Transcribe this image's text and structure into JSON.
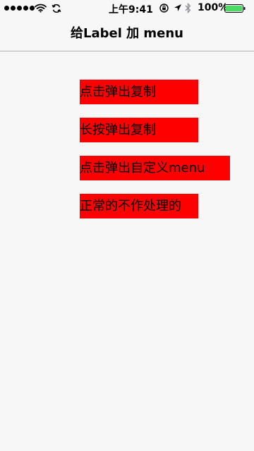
{
  "status_bar": {
    "time": "上午9:41",
    "battery_percent": "100%",
    "battery_color": "#4cd964",
    "icons": [
      "signal-dots-icon",
      "wifi-icon",
      "sync-icon",
      "lock-rotation-icon",
      "location-icon",
      "bluetooth-icon",
      "battery-icon"
    ]
  },
  "nav": {
    "title": "给Label 加 menu"
  },
  "labels": [
    {
      "text": "点击弹出复制"
    },
    {
      "text": "长按弹出复制"
    },
    {
      "text": "点击弹出自定义menu"
    },
    {
      "text": "正常的不作处理的"
    }
  ],
  "colors": {
    "label_background": "#ff0000",
    "page_background": "#f7f7f8",
    "nav_divider": "#b2b2b2"
  }
}
